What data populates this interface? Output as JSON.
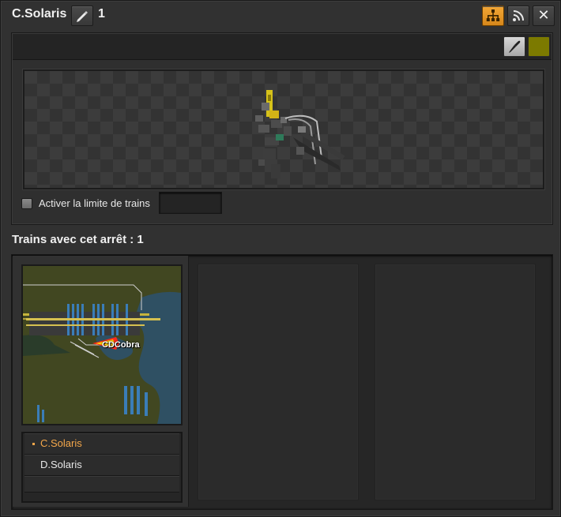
{
  "window": {
    "title": "C.Solaris",
    "stop_count": "1",
    "buttons": {
      "edit": "pencil-icon",
      "map_view": "network-icon",
      "circuit": "wireless-signal-icon",
      "close": "✕"
    }
  },
  "toolbar": {
    "color_picker": "eyedropper-icon",
    "station_color": "#7c7a00"
  },
  "train_limit": {
    "label": "Activer la limite de trains",
    "checked": false,
    "value": ""
  },
  "trains_section": {
    "heading": "Trains avec cet arrêt : 1",
    "trains": [
      {
        "name": "CDCobra",
        "schedule": [
          {
            "station": "C.Solaris",
            "current": true
          },
          {
            "station": "D.Solaris",
            "current": false
          }
        ]
      }
    ]
  },
  "colors": {
    "accent_orange": "#f4a74a",
    "button_active": "#e9982a"
  }
}
